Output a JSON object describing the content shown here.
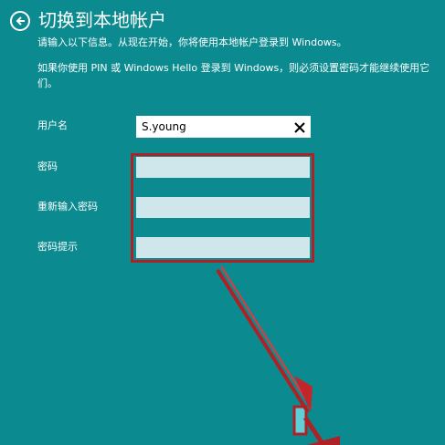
{
  "header": {
    "title": "切换到本地帐户",
    "back_icon": "back-arrow-circle-icon"
  },
  "descriptions": {
    "line1": "请输入以下信息。从现在开始，你将使用本地帐户登录到 Windows。",
    "line2": "如果你使用 PIN 或 Windows Hello 登录到 Windows，则必须设置密码才能继续使用它们。"
  },
  "form": {
    "username_label": "用户名",
    "username_value": "S.young",
    "password_label": "密码",
    "reenter_label": "重新输入密码",
    "hint_label": "密码提示"
  },
  "colors": {
    "background": "#0b8a8f",
    "field_fill": "#cfe7ea",
    "annotation": "#b02125"
  }
}
